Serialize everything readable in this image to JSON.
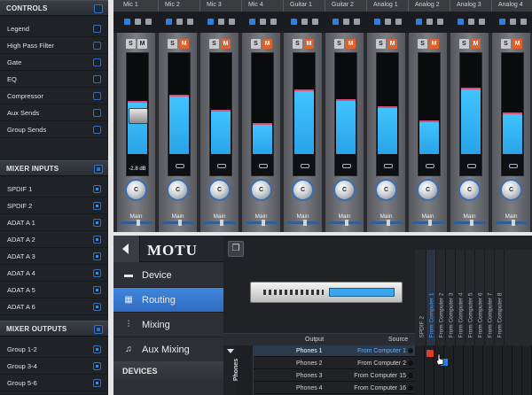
{
  "left_panel": {
    "controls": {
      "title": "CONTROLS",
      "items": [
        "Legend",
        "High Pass Filter",
        "Gate",
        "EQ",
        "Compressor",
        "Aux Sends",
        "Group Sends"
      ]
    },
    "mixer_inputs": {
      "title": "MIXER INPUTS",
      "items": [
        "SPDIF 1",
        "SPDIF 2",
        "ADAT A 1",
        "ADAT A 2",
        "ADAT A 3",
        "ADAT A 4",
        "ADAT A 5",
        "ADAT A 6"
      ]
    },
    "mixer_outputs": {
      "title": "MIXER OUTPUTS",
      "items": [
        "Group 1-2",
        "Group 3-4",
        "Group 5-6"
      ]
    }
  },
  "mixer": {
    "channels": [
      {
        "name": "Mic 1",
        "level": 0.53,
        "mute_active": false,
        "db": "-2.8 dB",
        "pan": "C",
        "bus": "Main"
      },
      {
        "name": "Mic 2",
        "level": 0.59,
        "mute_active": true,
        "db": "",
        "pan": "C",
        "bus": "Main"
      },
      {
        "name": "Mic 3",
        "level": 0.44,
        "mute_active": true,
        "db": "",
        "pan": "C",
        "bus": "Main"
      },
      {
        "name": "Mic 4",
        "level": 0.31,
        "mute_active": true,
        "db": "",
        "pan": "C",
        "bus": "Main"
      },
      {
        "name": "Guitar 1",
        "level": 0.64,
        "mute_active": true,
        "db": "",
        "pan": "C",
        "bus": "Main"
      },
      {
        "name": "Guitar 2",
        "level": 0.54,
        "mute_active": true,
        "db": "",
        "pan": "C",
        "bus": "Main"
      },
      {
        "name": "Analog 1",
        "level": 0.47,
        "mute_active": true,
        "db": "",
        "pan": "C",
        "bus": "Main"
      },
      {
        "name": "Analog 2",
        "level": 0.33,
        "mute_active": true,
        "db": "",
        "pan": "C",
        "bus": "Main"
      },
      {
        "name": "Analog 3",
        "level": 0.66,
        "mute_active": true,
        "db": "",
        "pan": "C",
        "bus": "Main"
      },
      {
        "name": "Analog 4",
        "level": 0.41,
        "mute_active": true,
        "db": "",
        "pan": "C",
        "bus": "Main"
      }
    ],
    "solo_label": "S",
    "mute_label": "M"
  },
  "nav": {
    "logo": "MOTU",
    "items": [
      {
        "label": "Device",
        "icon": "device-icon",
        "selected": false
      },
      {
        "label": "Routing",
        "icon": "routing-grid-icon",
        "selected": true
      },
      {
        "label": "Mixing",
        "icon": "mixing-sliders-icon",
        "selected": false
      },
      {
        "label": "Aux Mixing",
        "icon": "aux-mixing-icon",
        "selected": false
      }
    ],
    "devices_label": "DEVICES"
  },
  "routing": {
    "output_header": "Output",
    "source_header": "Source",
    "group_label": "Phones",
    "rows": [
      {
        "output": "Phones 1",
        "source": "From Computer 1",
        "selected": true
      },
      {
        "output": "Phones 2",
        "source": "From Computer 2",
        "selected": false
      },
      {
        "output": "Phones 3",
        "source": "From Computer 15",
        "selected": false
      },
      {
        "output": "Phones 4",
        "source": "From Computer 16",
        "selected": false
      }
    ],
    "columns": [
      "SPDIF 2",
      "From Computer 1",
      "From Computer 2",
      "From Computer 3",
      "From Computer 4",
      "From Computer 5",
      "From Computer 6",
      "From Computer 7",
      "From Computer 8"
    ],
    "highlight_color": "#e23b2a",
    "accent_color": "#2f7fe0"
  }
}
